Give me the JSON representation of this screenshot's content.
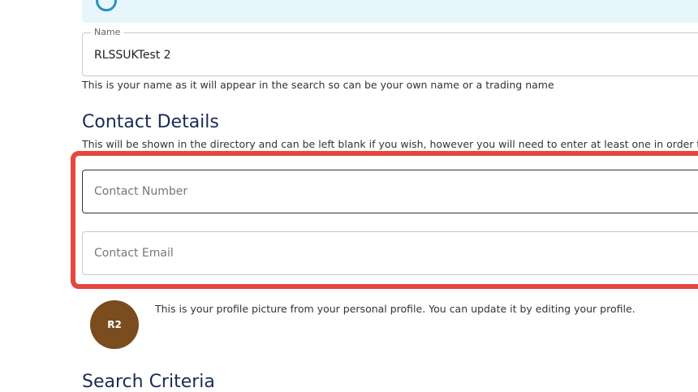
{
  "name_field": {
    "legend": "Name",
    "value": "RLSSUKTest 2",
    "helper": "This is your name as it will appear in the search so can be your own name or a trading name"
  },
  "contact_details": {
    "heading": "Contact Details",
    "description": "This will be shown in the directory and can be left blank if you wish, however you will need to enter at least one in order to b",
    "phone_placeholder": "Contact Number",
    "email_placeholder": "Contact Email"
  },
  "profile": {
    "avatar_initials": "R2",
    "note": "This is your profile picture from your personal profile. You can update it by editing your profile."
  },
  "search_criteria": {
    "heading": "Search Criteria"
  },
  "colors": {
    "highlight": "#e5473d",
    "heading": "#1a2b52",
    "avatar": "#7a4c1e",
    "banner": "#e6f6fb"
  }
}
